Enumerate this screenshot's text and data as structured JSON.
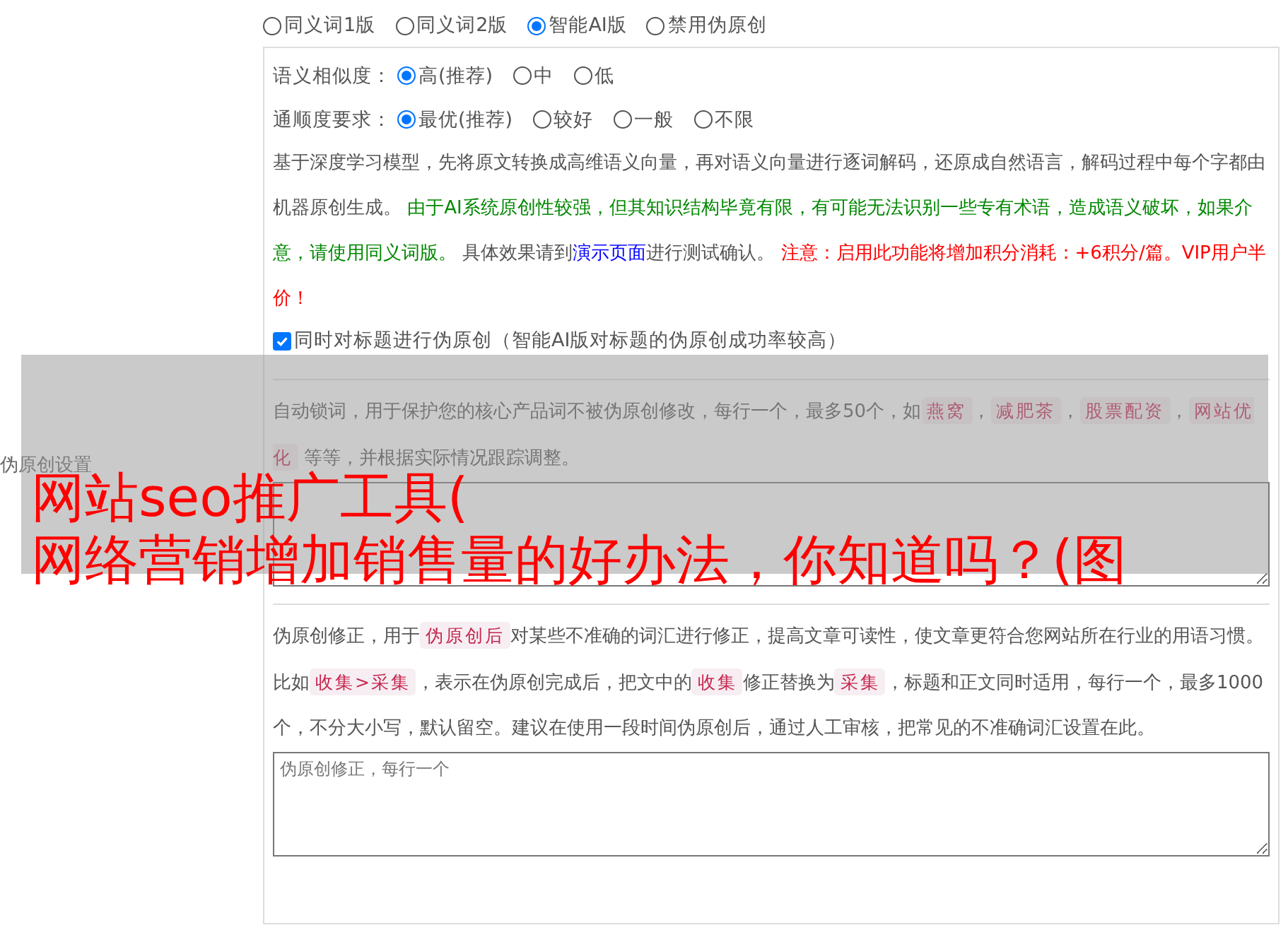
{
  "section_label": "伪原创设置",
  "modes": [
    {
      "label": "同义词1版",
      "selected": false
    },
    {
      "label": "同义词2版",
      "selected": false
    },
    {
      "label": "智能AI版",
      "selected": true
    },
    {
      "label": "禁用伪原创",
      "selected": false
    }
  ],
  "option_groups": [
    {
      "label": "语义相似度：",
      "options": [
        {
          "label": "高(推荐)",
          "selected": true
        },
        {
          "label": "中",
          "selected": false
        },
        {
          "label": "低",
          "selected": false
        }
      ]
    },
    {
      "label": "通顺度要求：",
      "options": [
        {
          "label": "最优(推荐)",
          "selected": true
        },
        {
          "label": "较好",
          "selected": false
        },
        {
          "label": "一般",
          "selected": false
        },
        {
          "label": "不限",
          "selected": false
        }
      ]
    }
  ],
  "description": [
    {
      "kind": "plain",
      "text": "基于深度学习模型，先将原文转换成高维语义向量，再对语义向量进行逐词解码，还原成自然语言，解码过程中每个字都由机器原创生成。 "
    },
    {
      "kind": "green",
      "text": "由于AI系统原创性较强，但其知识结构毕竟有限，有可能无法识别一些专有术语，造成语义破坏，如果介意，请使用同义词版。"
    },
    {
      "kind": "plain",
      "text": " 具体效果请到"
    },
    {
      "kind": "link",
      "text": "演示页面"
    },
    {
      "kind": "plain",
      "text": "进行测试确认。 "
    },
    {
      "kind": "red",
      "text": "注意：启用此功能将增加积分消耗：+6积分/篇。VIP用户半价！"
    }
  ],
  "title_option": {
    "label": "同时对标题进行伪原创（智能AI版对标题的伪原创成功率较高）",
    "checked": true
  },
  "lock_words": {
    "description": [
      {
        "kind": "plain",
        "text": "自动锁词，用于保护您的核心产品词不被伪原创修改，每行一个，最多50个，如"
      },
      {
        "kind": "code",
        "text": "燕窝"
      },
      {
        "kind": "plain",
        "text": "，"
      },
      {
        "kind": "code",
        "text": "减肥茶"
      },
      {
        "kind": "plain",
        "text": "，"
      },
      {
        "kind": "code",
        "text": "股票配资"
      },
      {
        "kind": "plain",
        "text": "，"
      },
      {
        "kind": "code",
        "text": "网站优化"
      },
      {
        "kind": "plain",
        "text": " 等等，并根据实际情况跟踪调整。"
      }
    ]
  },
  "corrections": {
    "description": [
      {
        "kind": "plain",
        "text": "伪原创修正，用于"
      },
      {
        "kind": "code",
        "text": "伪原创后"
      },
      {
        "kind": "plain",
        "text": "对某些不准确的词汇进行修正，提高文章可读性，使文章更符合您网站所在行业的用语习惯。比如"
      },
      {
        "kind": "code",
        "text": "收集>采集"
      },
      {
        "kind": "plain",
        "text": "，表示在伪原创完成后，把文中的"
      },
      {
        "kind": "code",
        "text": "收集"
      },
      {
        "kind": "plain",
        "text": "修正替换为"
      },
      {
        "kind": "code",
        "text": "采集"
      },
      {
        "kind": "plain",
        "text": "，标题和正文同时适用，每行一个，最多1000个，不分大小写，默认留空。建议在使用一段时间伪原创后，通过人工审核，把常见的不准确词汇设置在此。"
      }
    ],
    "placeholder": "伪原创修正，每行一个"
  },
  "overlay_caption": [
    "网站seo推广工具(",
    "网络营销增加销售量的好办法，你知道吗？(图"
  ]
}
